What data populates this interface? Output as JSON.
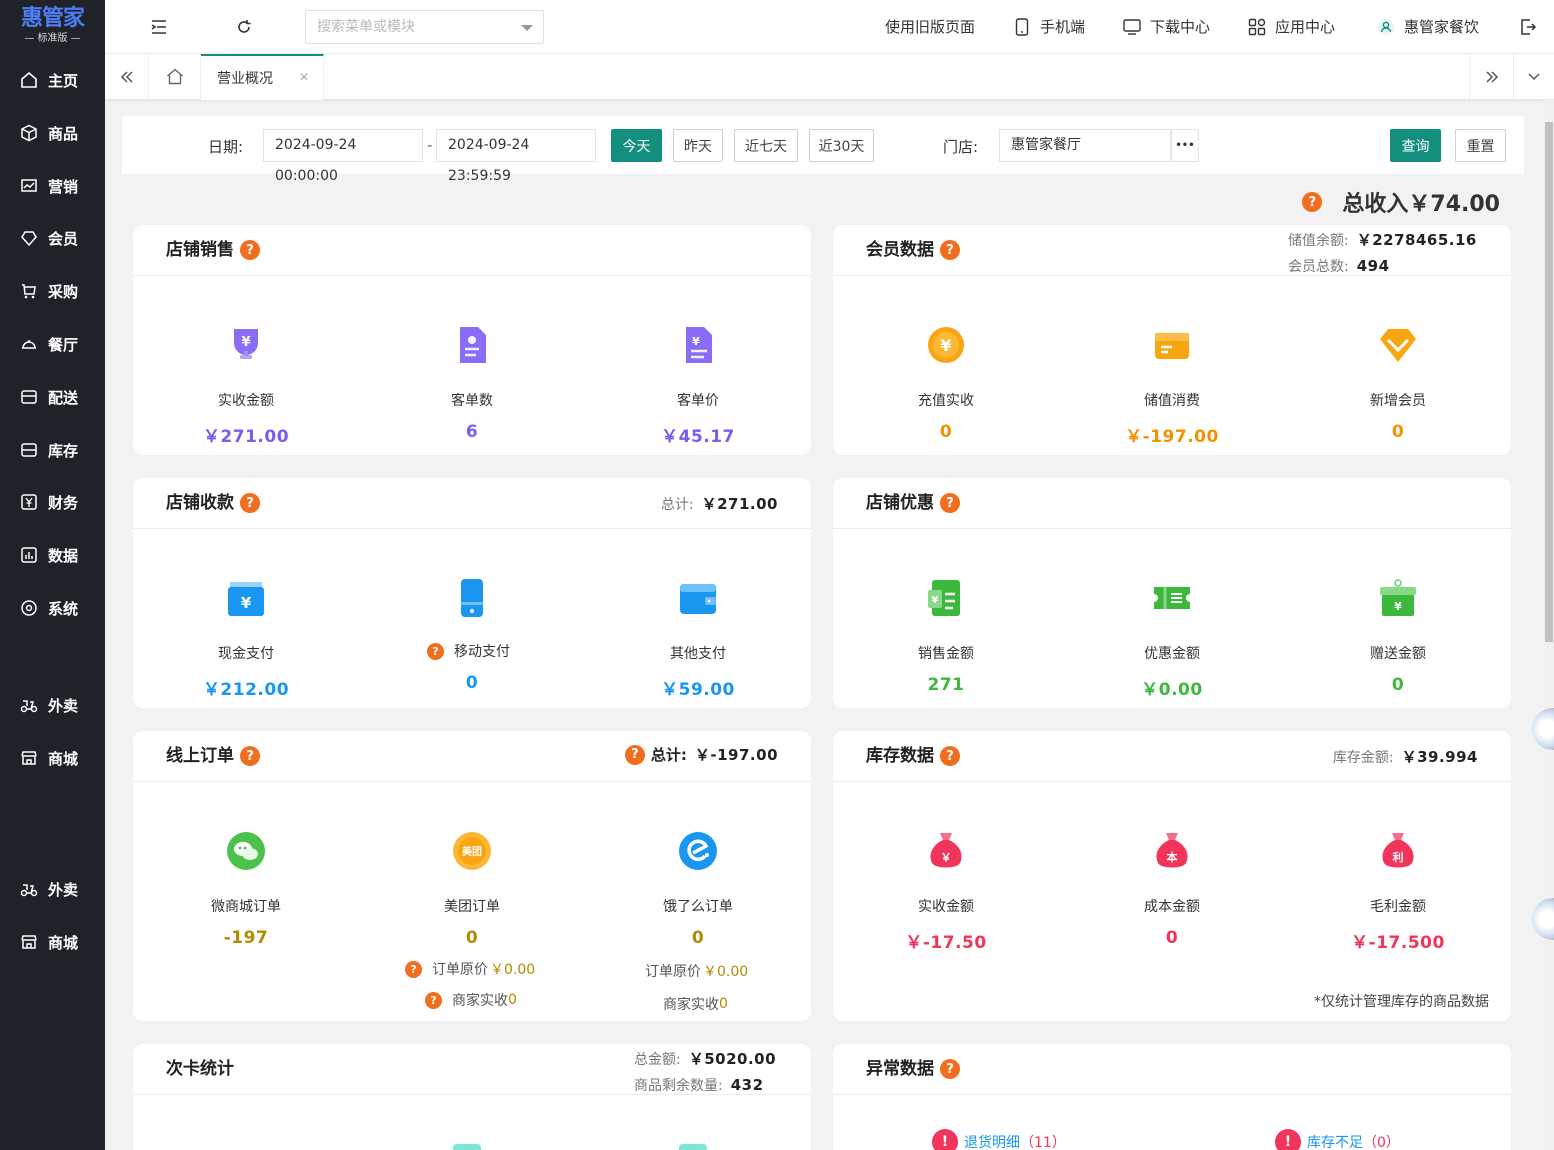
{
  "sidebar": {
    "logo": "惠管家",
    "edition": "— 标准版 —",
    "items": [
      {
        "label": "主页",
        "icon": "home-icon"
      },
      {
        "label": "商品",
        "icon": "cube-icon"
      },
      {
        "label": "营销",
        "icon": "chart-icon"
      },
      {
        "label": "会员",
        "icon": "diamond-icon"
      },
      {
        "label": "采购",
        "icon": "cart-icon"
      },
      {
        "label": "餐厅",
        "icon": "dish-icon"
      },
      {
        "label": "配送",
        "icon": "truck-icon"
      },
      {
        "label": "库存",
        "icon": "box-icon"
      },
      {
        "label": "财务",
        "icon": "yuan-icon"
      },
      {
        "label": "数据",
        "icon": "bar-icon"
      },
      {
        "label": "系统",
        "icon": "gear-icon"
      },
      {
        "label": "外卖",
        "icon": "scooter-icon"
      },
      {
        "label": "商城",
        "icon": "store-icon"
      },
      {
        "label": "外卖",
        "icon": "scooter-icon"
      },
      {
        "label": "商城",
        "icon": "store-icon"
      }
    ]
  },
  "topbar": {
    "search_placeholder": "搜索菜单或模块",
    "old_page": "使用旧版页面",
    "mobile": "手机端",
    "download": "下载中心",
    "apps": "应用中心",
    "user": "惠管家餐饮"
  },
  "tabs": {
    "active": "营业概况"
  },
  "filter": {
    "date_label": "日期:",
    "start": "2024-09-24 00:00:00",
    "sep": "-",
    "end": "2024-09-24 23:59:59",
    "today": "今天",
    "yesterday": "昨天",
    "week": "近七天",
    "month": "近30天",
    "store_label": "门店:",
    "store": "惠管家餐厅",
    "more": "•••",
    "query": "查询",
    "reset": "重置"
  },
  "total": {
    "label": "总收入",
    "value": "￥74.00"
  },
  "store_sales": {
    "title": "店铺销售",
    "items": [
      {
        "label": "实收金额",
        "value": "￥271.00"
      },
      {
        "label": "客单数",
        "value": "6"
      },
      {
        "label": "客单价",
        "value": "￥45.17"
      }
    ]
  },
  "member": {
    "title": "会员数据",
    "balance_label": "储值余额:",
    "balance": "￥2278465.16",
    "count_label": "会员总数:",
    "count": "494",
    "items": [
      {
        "label": "充值实收",
        "value": "0"
      },
      {
        "label": "储值消费",
        "value": "￥-197.00"
      },
      {
        "label": "新增会员",
        "value": "0"
      }
    ]
  },
  "payments": {
    "title": "店铺收款",
    "total_label": "总计:",
    "total": "￥271.00",
    "items": [
      {
        "label": "现金支付",
        "value": "￥212.00"
      },
      {
        "label": "移动支付",
        "value": "0"
      },
      {
        "label": "其他支付",
        "value": "￥59.00"
      }
    ]
  },
  "discounts": {
    "title": "店铺优惠",
    "items": [
      {
        "label": "销售金额",
        "value": "271"
      },
      {
        "label": "优惠金额",
        "value": "￥0.00"
      },
      {
        "label": "赠送金额",
        "value": "0"
      }
    ]
  },
  "online": {
    "title": "线上订单",
    "total_label": "总计:",
    "total": "￥-197.00",
    "items": [
      {
        "label": "微商城订单",
        "value": "-197"
      },
      {
        "label": "美团订单",
        "value": "0"
      },
      {
        "label": "饿了么订单",
        "value": "0"
      }
    ],
    "meituan_orig_label": "订单原价",
    "meituan_orig": "￥0.00",
    "meituan_actual_label": "商家实收",
    "meituan_actual": "0",
    "eleme_orig_label": "订单原价",
    "eleme_orig": "￥0.00",
    "eleme_actual_label": "商家实收",
    "eleme_actual": "0",
    "meituan_logo": "美团"
  },
  "inventory": {
    "title": "库存数据",
    "amount_label": "库存金额:",
    "amount": "￥39.994",
    "items": [
      {
        "label": "实收金额",
        "value": "￥-17.50"
      },
      {
        "label": "成本金额",
        "value": "0"
      },
      {
        "label": "毛利金额",
        "value": "￥-17.500"
      }
    ],
    "note": "*仅统计管理库存的商品数据",
    "bag_marks": [
      "￥",
      "本",
      "利"
    ]
  },
  "card_stats": {
    "title": "次卡统计",
    "total_label": "总金额:",
    "total": "￥5020.00",
    "remain_label": "商品剩余数量:",
    "remain": "432"
  },
  "abnormal": {
    "title": "异常数据",
    "returns": "退货明细",
    "returns_count": "（11）",
    "shortage": "库存不足",
    "shortage_count": "（0）"
  },
  "colors": {
    "sidebar": "#1f2329",
    "accent": "#138f7f",
    "purple": "#7b5cf0",
    "orange": "#f39200",
    "blue": "#1896f0",
    "green": "#3cb93c",
    "olive": "#b38a00",
    "red": "#f0345a",
    "question": "#f06e1d"
  }
}
